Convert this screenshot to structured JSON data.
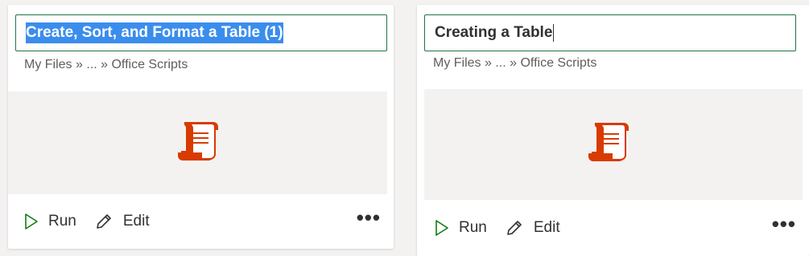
{
  "cards": [
    {
      "title_selected": "Create, Sort, and Format a Table (1)",
      "breadcrumb": "My Files » ... » Office Scripts",
      "run_label": "Run",
      "edit_label": "Edit",
      "more_label": "•••"
    },
    {
      "title": "Creating a Table",
      "breadcrumb": "My Files » ... » Office Scripts",
      "run_label": "Run",
      "edit_label": "Edit",
      "more_label": "•••"
    }
  ],
  "colors": {
    "accent_border": "#217346",
    "selection_bg": "#3b8ded",
    "script_icon": "#d83b01",
    "run_icon": "#107c10"
  },
  "icons": {
    "script": "office-script-icon",
    "run": "play-icon",
    "edit": "pencil-icon",
    "more": "more-options-icon"
  }
}
